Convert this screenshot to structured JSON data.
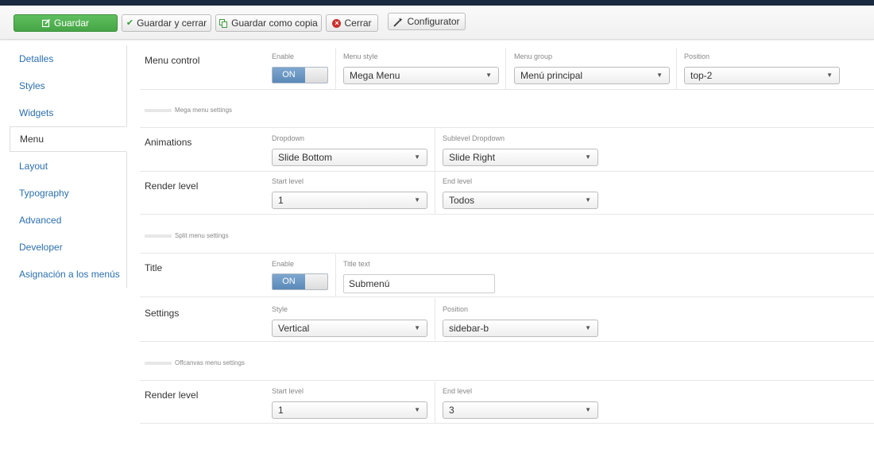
{
  "toolbar": {
    "save": "Guardar",
    "save_close": "Guardar y cerrar",
    "save_copy": "Guardar como copia",
    "close": "Cerrar",
    "configurator": "Configurator"
  },
  "sidebar": {
    "items": [
      {
        "label": "Detalles"
      },
      {
        "label": "Styles"
      },
      {
        "label": "Widgets"
      },
      {
        "label": "Menu"
      },
      {
        "label": "Layout"
      },
      {
        "label": "Typography"
      },
      {
        "label": "Advanced"
      },
      {
        "label": "Developer"
      },
      {
        "label": "Asignación a los menús"
      }
    ],
    "active": "Menu"
  },
  "menu_control": {
    "label": "Menu control",
    "enable_label": "Enable",
    "enable_value": "ON",
    "style_label": "Menu style",
    "style_value": "Mega Menu",
    "group_label": "Menu group",
    "group_value": "Menú principal",
    "position_label": "Position",
    "position_value": "top-2"
  },
  "mega": {
    "section_title": "Mega menu settings",
    "animations": {
      "label": "Animations",
      "dropdown_label": "Dropdown",
      "dropdown_value": "Slide Bottom",
      "sublevel_label": "Sublevel Dropdown",
      "sublevel_value": "Slide Right"
    },
    "render": {
      "label": "Render level",
      "start_label": "Start level",
      "start_value": "1",
      "end_label": "End level",
      "end_value": "Todos"
    }
  },
  "split": {
    "section_title": "Split menu settings",
    "title": {
      "label": "Title",
      "enable_label": "Enable",
      "enable_value": "ON",
      "text_label": "Title text",
      "text_value": "Submenú"
    },
    "settings": {
      "label": "Settings",
      "style_label": "Style",
      "style_value": "Vertical",
      "position_label": "Position",
      "position_value": "sidebar-b"
    }
  },
  "offcanvas": {
    "section_title": "Offcanvas menu settings",
    "render": {
      "label": "Render level",
      "start_label": "Start level",
      "start_value": "1",
      "end_label": "End level",
      "end_value": "3"
    }
  },
  "colors": {
    "primary_button": "#46a546",
    "link": "#2a6fad",
    "toggle_on": "#6a97c4",
    "header_bar": "#1a2a3f"
  }
}
